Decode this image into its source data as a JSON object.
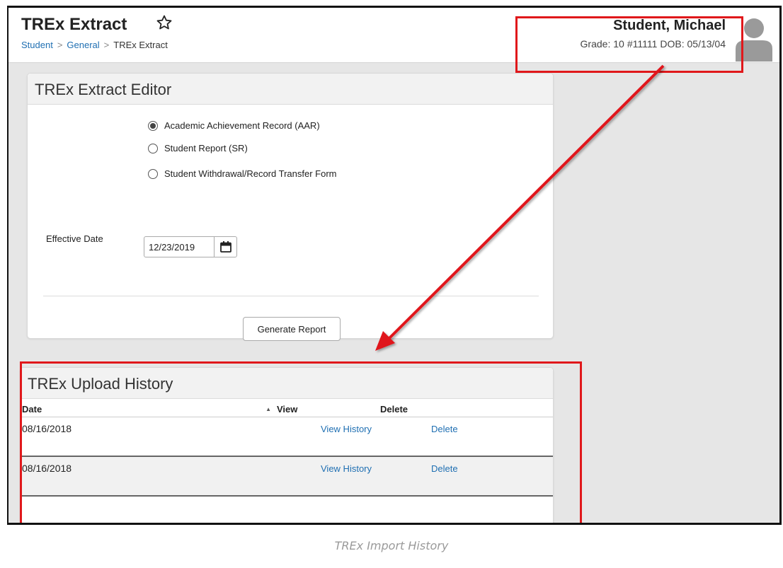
{
  "header": {
    "title": "TREx Extract",
    "breadcrumb": [
      "Student",
      "General",
      "TREx Extract"
    ],
    "student_name": "Student, Michael",
    "grade": "Grade: 10",
    "student_number": "#11111",
    "dob": "DOB: 05/13/04"
  },
  "editor": {
    "title": "TREx Extract Editor",
    "options": [
      {
        "label": "Academic Achievement Record (AAR)",
        "selected": true
      },
      {
        "label": "Student Report (SR)",
        "selected": false
      },
      {
        "label": "Student Withdrawal/Record Transfer Form",
        "selected": false
      }
    ],
    "effective_date_label": "Effective Date",
    "effective_date_value": "12/23/2019",
    "generate_label": "Generate Report"
  },
  "history": {
    "title": "TREx Upload History",
    "columns": [
      "Date",
      "View",
      "Delete"
    ],
    "rows": [
      {
        "date": "08/16/2018",
        "view": "View History",
        "delete": "Delete"
      },
      {
        "date": "08/16/2018",
        "view": "View History",
        "delete": "Delete"
      }
    ]
  },
  "caption": "TREx Import History",
  "colors": {
    "accent_link": "#1f6fb2",
    "annotation": "#e0181b"
  },
  "icons": [
    "star-icon",
    "avatar-icon",
    "calendar-icon",
    "sort-asc-icon"
  ]
}
